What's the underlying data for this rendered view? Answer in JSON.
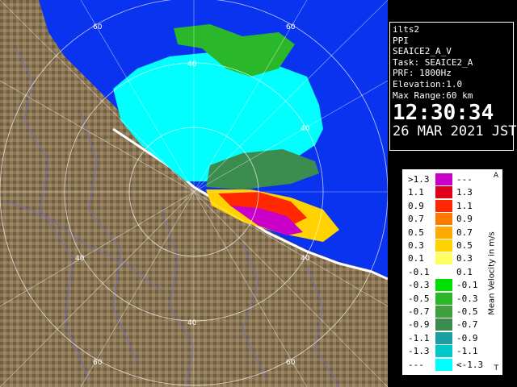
{
  "radar": {
    "range_labels": [
      "60",
      "40",
      "60",
      "40",
      "40",
      "40",
      "60",
      "40",
      "60"
    ],
    "colors": {
      "sea": "#0a33f0",
      "land": "#8a7656",
      "background": "#000000"
    }
  },
  "info": {
    "site": "ilts2",
    "mode": "PPI",
    "scan": "SEAICE2_A_V",
    "task": "Task: SEAICE2_A",
    "prf": "PRF: 1800Hz",
    "elevation": "Elevation:1.0",
    "max_range": "Max Range:60 km",
    "time": "12:30:34",
    "date": "26 MAR 2021 JST"
  },
  "legend": {
    "title": "Mean Velocity in m/s",
    "corner_top": "A",
    "corner_bottom": "T",
    "rows": [
      {
        "lo": ">1.3",
        "hi": "---",
        "color": "#c800c8"
      },
      {
        "lo": "1.1",
        "hi": "1.3",
        "color": "#e0001a"
      },
      {
        "lo": "0.9",
        "hi": "1.1",
        "color": "#ff2800"
      },
      {
        "lo": "0.7",
        "hi": "0.9",
        "color": "#ff7a00"
      },
      {
        "lo": "0.5",
        "hi": "0.7",
        "color": "#ffaa00"
      },
      {
        "lo": "0.3",
        "hi": "0.5",
        "color": "#ffd200"
      },
      {
        "lo": "0.1",
        "hi": "0.3",
        "color": "#ffff64"
      },
      {
        "lo": "-0.1",
        "hi": "0.1",
        "color": "#ffffff"
      },
      {
        "lo": "-0.3",
        "hi": "-0.1",
        "color": "#00e000"
      },
      {
        "lo": "-0.5",
        "hi": "-0.3",
        "color": "#2ab82a"
      },
      {
        "lo": "-0.7",
        "hi": "-0.5",
        "color": "#40a040"
      },
      {
        "lo": "-0.9",
        "hi": "-0.7",
        "color": "#3c8c50"
      },
      {
        "lo": "-1.1",
        "hi": "-0.9",
        "color": "#1aa0a0"
      },
      {
        "lo": "-1.3",
        "hi": "-1.1",
        "color": "#00c8c8"
      },
      {
        "lo": "---",
        "hi": "<-1.3",
        "color": "#00ffff"
      }
    ]
  }
}
